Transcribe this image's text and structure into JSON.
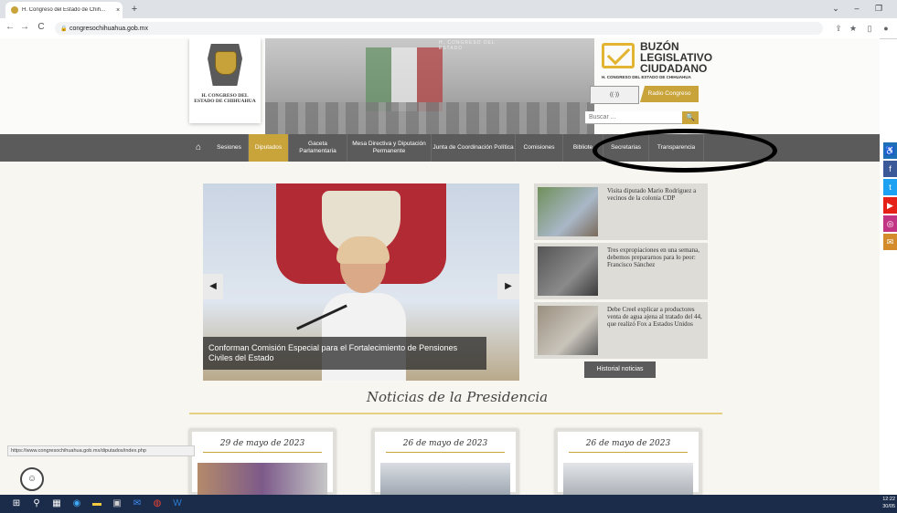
{
  "browser": {
    "tab_title": "H. Congreso del Estado de Chih...",
    "close_glyph": "×",
    "new_tab_glyph": "+",
    "url": "congresochihuahua.gob.mx",
    "status_url": "https://www.congresochihuahua.gob.mx/diputados/index.php"
  },
  "header": {
    "logo_text": "H. CONGRESO DEL ESTADO DE CHIHUAHUA",
    "banner_engraving": "H. CONGRESO DEL ESTADO",
    "buzon_title": "BUZÓN LEGISLATIVO CIUDADANO",
    "buzon_sub": "H. CONGRESO DEL ESTADO DE CHIHUAHUA",
    "radio_icon_label": "((·))",
    "radio_label": "Radio Congreso",
    "search_placeholder": "Buscar ...",
    "search_glyph": "🔍"
  },
  "nav": {
    "home_glyph": "⌂",
    "items": [
      {
        "label": "Sesiones"
      },
      {
        "label": "Diputados"
      },
      {
        "label": "Gaceta Parlamentaria"
      },
      {
        "label": "Mesa Directiva y Diputación Permanente"
      },
      {
        "label": "Junta de Coordinación Política"
      },
      {
        "label": "Comisiones"
      },
      {
        "label": "Bibliote"
      },
      {
        "label": "Secretarias"
      },
      {
        "label": "Transparencia"
      }
    ],
    "active_index": 1
  },
  "carousel": {
    "caption": "Conforman Comisión Especial para el Fortalecimiento de Pensiones Civiles del Estado",
    "prev_glyph": "◀",
    "next_glyph": "▶"
  },
  "news": [
    {
      "text": "Visita diputado Mario Rodríguez a vecinos de la colonia CDP"
    },
    {
      "text": "Tres expropiaciones en una semana, debemos prepararnos para lo peor: Francisco Sánchez"
    },
    {
      "text": "Debe Creel explicar a productores venta de agua ajena al tratado del 44, que realizó Fox a Estados Unidos"
    }
  ],
  "history_button": "Historial noticias",
  "presidencia": {
    "title": "Noticias de la Presidencia",
    "cards": [
      {
        "date": "29 de mayo de 2023"
      },
      {
        "date": "26 de mayo de 2023"
      },
      {
        "date": "26 de mayo de 2023"
      }
    ]
  },
  "social": [
    {
      "name": "accessibility",
      "glyph": "♿",
      "color": "#1d6fb8"
    },
    {
      "name": "facebook",
      "glyph": "f",
      "color": "#3b5998"
    },
    {
      "name": "twitter",
      "glyph": "t",
      "color": "#1da1f2"
    },
    {
      "name": "youtube",
      "glyph": "▶",
      "color": "#e62117"
    },
    {
      "name": "instagram",
      "glyph": "◎",
      "color": "#c13584"
    },
    {
      "name": "email",
      "glyph": "✉",
      "color": "#d38b2b"
    }
  ],
  "accessibility_glyph": "☺",
  "clock": {
    "time": "12:22",
    "date": "30/05"
  },
  "colors": {
    "accent": "#c8a43b",
    "nav_bg": "#5b5b5b",
    "annotation": "#000000"
  }
}
